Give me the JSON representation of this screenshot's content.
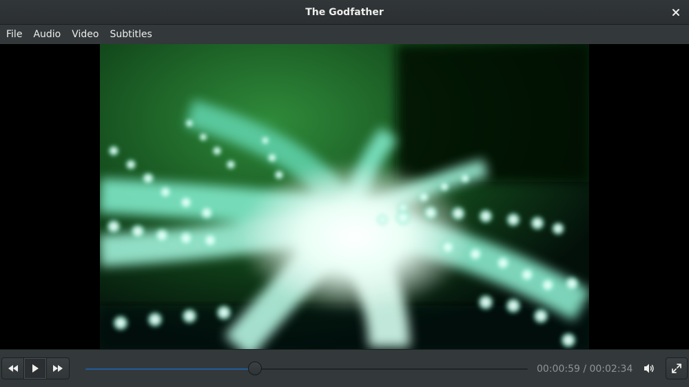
{
  "window": {
    "title": "The Godfather",
    "close_icon": "close-icon"
  },
  "menu": {
    "items": [
      "File",
      "Audio",
      "Video",
      "Subtitles"
    ]
  },
  "player": {
    "progress": 0.383,
    "current_time": "00:00:59",
    "duration": "00:02:34",
    "time_display": "00:00:59 / 00:02:34",
    "state": "paused"
  },
  "controls": {
    "rewind_icon": "rewind-icon",
    "play_icon": "play-icon",
    "forward_icon": "fast-forward-icon",
    "volume_icon": "volume-icon",
    "fullscreen_icon": "fullscreen-icon"
  },
  "colors": {
    "accent": "#215d9c",
    "chrome": "#33393b",
    "text": "#eeeeec",
    "time_text": "#8f9597"
  }
}
